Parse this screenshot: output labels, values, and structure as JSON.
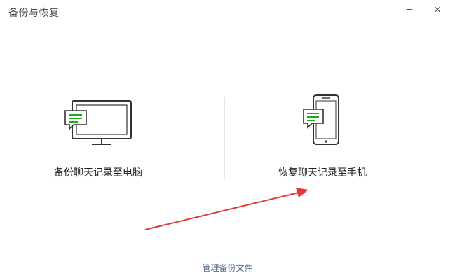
{
  "window": {
    "title": "备份与恢复",
    "minimize_label": "−",
    "close_label": "×"
  },
  "options": [
    {
      "label": "备份聊天记录至电脑",
      "icon": "computer-chat-icon"
    },
    {
      "label": "恢复聊天记录至手机",
      "icon": "phone-chat-icon"
    }
  ],
  "footer": {
    "manage_label": "管理备份文件"
  },
  "colors": {
    "accent_green": "#1aad19",
    "annotation_red": "#e53935",
    "icon_stroke": "#333333"
  }
}
